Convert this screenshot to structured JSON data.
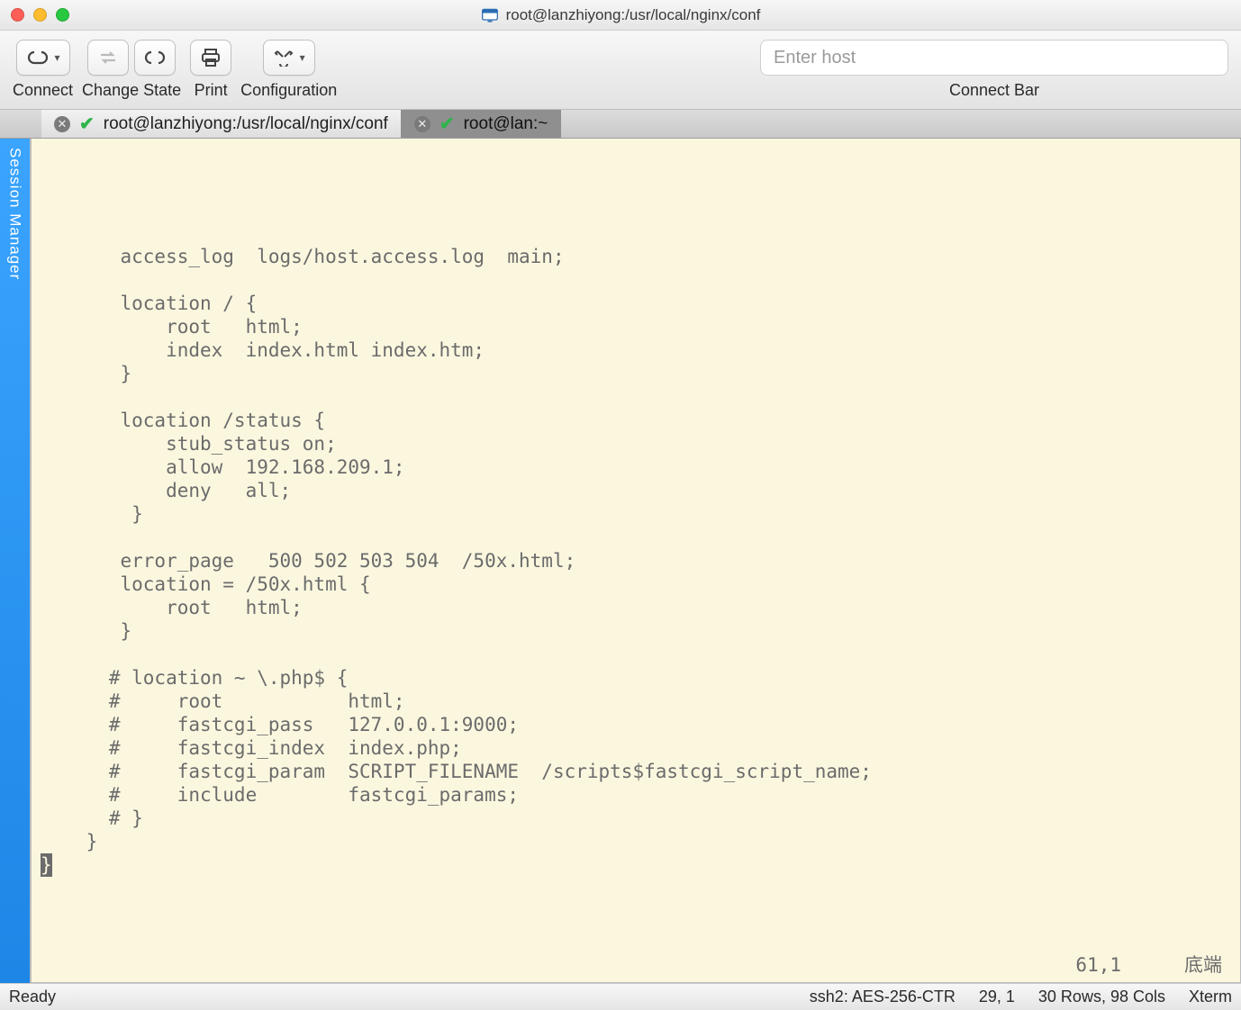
{
  "window": {
    "title": "root@lanzhiyong:/usr/local/nginx/conf"
  },
  "toolbar": {
    "connect_label": "Connect",
    "change_state_label": "Change State",
    "print_label": "Print",
    "configuration_label": "Configuration",
    "connect_bar_label": "Connect Bar",
    "host_placeholder": "Enter host"
  },
  "session_manager_label": "Session Manager",
  "tabs": [
    {
      "title": "root@lanzhiyong:/usr/local/nginx/conf",
      "active": true
    },
    {
      "title": "root@lan:~",
      "active": false
    }
  ],
  "terminal": {
    "lines": [
      "",
      "",
      "",
      "       access_log  logs/host.access.log  main;",
      "",
      "       location / {",
      "           root   html;",
      "           index  index.html index.htm;",
      "       }",
      "",
      "       location /status {",
      "           stub_status on;",
      "           allow  192.168.209.1;",
      "           deny   all;",
      "        }",
      "",
      "       error_page   500 502 503 504  /50x.html;",
      "       location = /50x.html {",
      "           root   html;",
      "       }",
      "",
      "      # location ~ \\.php$ {",
      "      #     root           html;",
      "      #     fastcgi_pass   127.0.0.1:9000;",
      "      #     fastcgi_index  index.php;",
      "      #     fastcgi_param  SCRIPT_FILENAME  /scripts$fastcgi_script_name;",
      "      #     include        fastcgi_params;",
      "      # }",
      "    }"
    ],
    "cursor_line_char": "}",
    "pos": "61,1",
    "mode": "底端"
  },
  "statusbar": {
    "left": "Ready",
    "conn": "ssh2: AES-256-CTR",
    "cursor": "29, 1",
    "dims": "30 Rows, 98 Cols",
    "term": "Xterm"
  }
}
